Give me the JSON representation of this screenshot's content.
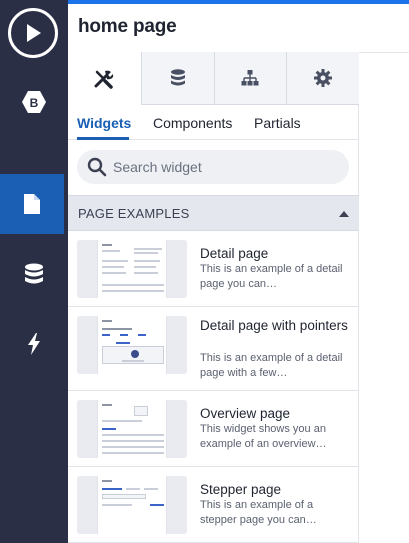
{
  "header": {
    "title": "home page"
  },
  "rail": {
    "items": [
      {
        "icon": "play-icon"
      },
      {
        "icon": "b-logo-icon",
        "label": "B"
      },
      {
        "icon": "page-icon",
        "active": true
      },
      {
        "icon": "database-icon"
      },
      {
        "icon": "lightning-icon"
      }
    ]
  },
  "tool_tabs": [
    {
      "icon": "tools-icon",
      "active": true
    },
    {
      "icon": "database-icon"
    },
    {
      "icon": "sitemap-icon"
    },
    {
      "icon": "gear-icon"
    }
  ],
  "sub_tabs": [
    {
      "label": "Widgets",
      "active": true
    },
    {
      "label": "Components"
    },
    {
      "label": "Partials"
    }
  ],
  "search": {
    "placeholder": "Search widget"
  },
  "section": {
    "title": "PAGE EXAMPLES",
    "expanded": true
  },
  "widgets": [
    {
      "title": "Detail page",
      "description": "This is an example of a detail page you can…"
    },
    {
      "title": "Detail page with pointers",
      "description": "This is an example of a detail page with a few…"
    },
    {
      "title": "Overview page",
      "description": "This widget shows you an example of an overview…"
    },
    {
      "title": "Stepper page",
      "description": "This is an example of a stepper page you can…"
    }
  ],
  "colors": {
    "rail": "#2a2f45",
    "accent": "#1a73e8",
    "active": "#1a5fb4"
  }
}
